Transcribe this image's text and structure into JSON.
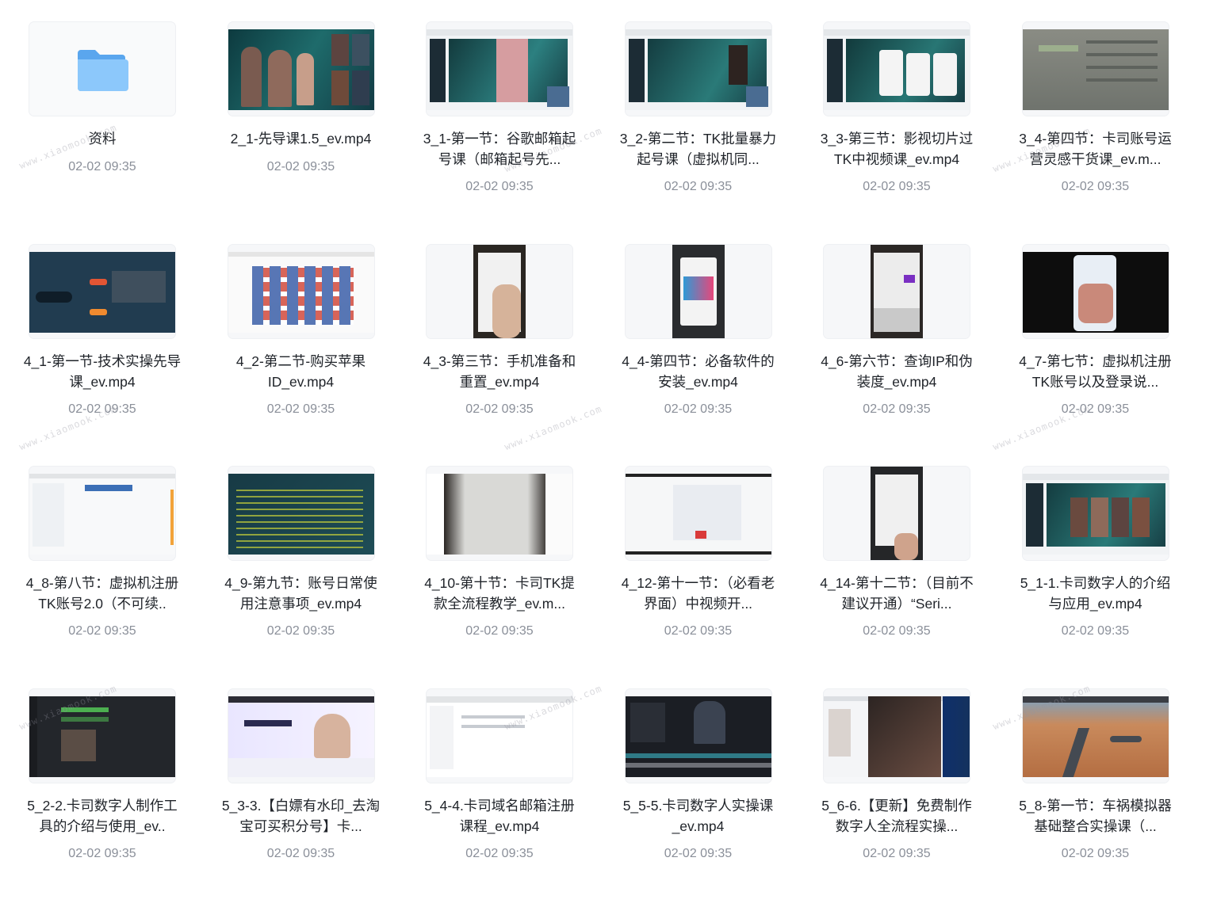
{
  "colors": {
    "title": "#1f2329",
    "time": "#8a8f99",
    "folder": "#6fb5f5"
  },
  "watermark_text": "www.xiaomook.com",
  "items": [
    {
      "name": "资料",
      "time": "02-02 09:35",
      "type": "folder",
      "icon": "folder-icon"
    },
    {
      "name": "2_1-先导课1.5_ev.mp4",
      "time": "02-02 09:35",
      "type": "video"
    },
    {
      "name": "3_1-第一节：谷歌邮箱起号课（邮箱起号先...",
      "time": "02-02 09:35",
      "type": "video"
    },
    {
      "name": "3_2-第二节：TK批量暴力起号课（虚拟机同...",
      "time": "02-02 09:35",
      "type": "video"
    },
    {
      "name": "3_3-第三节：影视切片过TK中视频课_ev.mp4",
      "time": "02-02 09:35",
      "type": "video"
    },
    {
      "name": "3_4-第四节：卡司账号运营灵感干货课_ev.m...",
      "time": "02-02 09:35",
      "type": "video"
    },
    {
      "name": "4_1-第一节-技术实操先导课_ev.mp4",
      "time": "02-02 09:35",
      "type": "video"
    },
    {
      "name": "4_2-第二节-购买苹果ID_ev.mp4",
      "time": "02-02 09:35",
      "type": "video"
    },
    {
      "name": "4_3-第三节：手机准备和重置_ev.mp4",
      "time": "02-02 09:35",
      "type": "video"
    },
    {
      "name": "4_4-第四节：必备软件的安装_ev.mp4",
      "time": "02-02 09:35",
      "type": "video"
    },
    {
      "name": "4_6-第六节：查询IP和伪装度_ev.mp4",
      "time": "02-02 09:35",
      "type": "video"
    },
    {
      "name": "4_7-第七节：虚拟机注册TK账号以及登录说...",
      "time": "02-02 09:35",
      "type": "video"
    },
    {
      "name": "4_8-第八节：虚拟机注册TK账号2.0（不可续..",
      "time": "02-02 09:35",
      "type": "video"
    },
    {
      "name": "4_9-第九节：账号日常使用注意事项_ev.mp4",
      "time": "02-02 09:35",
      "type": "video"
    },
    {
      "name": "4_10-第十节：卡司TK提款全流程教学_ev.m...",
      "time": "02-02 09:35",
      "type": "video"
    },
    {
      "name": "4_12-第十一节：（必看老界面）中视频开...",
      "time": "02-02 09:35",
      "type": "video"
    },
    {
      "name": "4_14-第十二节：（目前不建议开通）“Seri...",
      "time": "02-02 09:35",
      "type": "video"
    },
    {
      "name": "5_1-1.卡司数字人的介绍与应用_ev.mp4",
      "time": "02-02 09:35",
      "type": "video"
    },
    {
      "name": "5_2-2.卡司数字人制作工具的介绍与使用_ev..",
      "time": "02-02 09:35",
      "type": "video"
    },
    {
      "name": "5_3-3.【白嫖有水印_去淘宝可买积分号】卡...",
      "time": "02-02 09:35",
      "type": "video"
    },
    {
      "name": "5_4-4.卡司域名邮箱注册课程_ev.mp4",
      "time": "02-02 09:35",
      "type": "video"
    },
    {
      "name": "5_5-5.卡司数字人实操课_ev.mp4",
      "time": "02-02 09:35",
      "type": "video"
    },
    {
      "name": "5_6-6.【更新】免费制作数字人全流程实操...",
      "time": "02-02 09:35",
      "type": "video"
    },
    {
      "name": "5_8-第一节：车祸模拟器基础整合实操课（...",
      "time": "02-02 09:35",
      "type": "video"
    }
  ]
}
